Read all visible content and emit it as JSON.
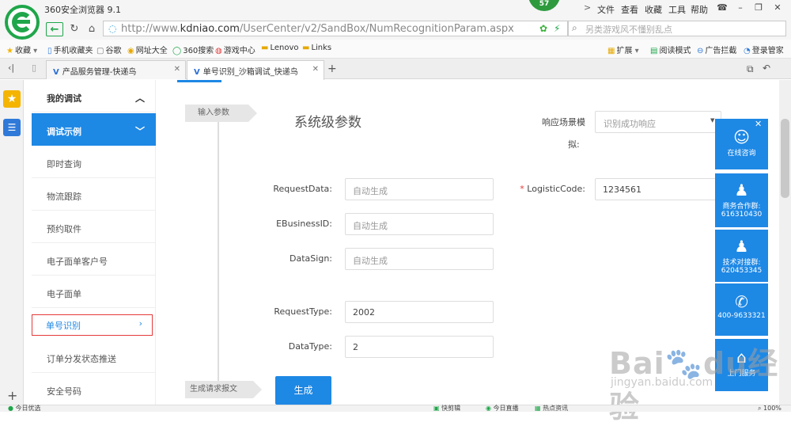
{
  "browser": {
    "title": "360安全浏览器 9.1",
    "badge": "57",
    "menus": [
      "文件",
      "查看",
      "收藏",
      "工具",
      "帮助"
    ],
    "url_prefix": "http://www.",
    "url_domain": "kdniao.com",
    "url_path": "/UserCenter/v2/SandBox/NumRecognitionParam.aspx",
    "search_placeholder": "另类游戏风不懂别乱点",
    "accent": "#1fa64a"
  },
  "bookmarks": {
    "left": [
      {
        "icon": "star-icon",
        "label": "收藏"
      },
      {
        "icon": "phone-icon",
        "label": "手机收藏夹"
      },
      {
        "icon": "page-icon",
        "label": "谷歌"
      },
      {
        "icon": "globe-icon",
        "label": "网址大全"
      },
      {
        "icon": "360-icon",
        "label": "360搜索"
      },
      {
        "icon": "game-icon",
        "label": "游戏中心"
      },
      {
        "icon": "folder-icon",
        "label": "Lenovo"
      },
      {
        "icon": "folder-icon",
        "label": "Links"
      }
    ],
    "right": [
      {
        "icon": "extension-icon",
        "label": "扩展"
      },
      {
        "icon": "reader-icon",
        "label": "阅读模式"
      },
      {
        "icon": "block-icon",
        "label": "广告拦截"
      },
      {
        "icon": "user-icon",
        "label": "登录管家"
      }
    ]
  },
  "tabs": [
    {
      "label": "产品服务管理-快递鸟",
      "active": false
    },
    {
      "label": "单号识别_沙箱调试_快递鸟",
      "active": true
    }
  ],
  "menu": {
    "head": "我的调试",
    "demo": "调试示例",
    "items": [
      "即时查询",
      "物流跟踪",
      "预约取件",
      "电子面单客户号",
      "电子面单",
      "单号识别",
      "订单分发状态推送",
      "安全号码"
    ],
    "selected": "单号识别"
  },
  "form": {
    "timeline_input": "输入参数",
    "timeline_generate": "生成请求报文",
    "section_title": "系统级参数",
    "scene_label_1": "响应场景模",
    "scene_label_2": "拟:",
    "scene_value": "识别成功响应",
    "request_data_label": "RequestData:",
    "request_data_placeholder": "自动生成",
    "logistic_required_mark": "*",
    "logistic_label": "LogisticCode:",
    "logistic_value": "1234561",
    "ebusiness_label": "EBusinessID:",
    "ebusiness_placeholder": "自动生成",
    "datasign_label": "DataSign:",
    "datasign_placeholder": "自动生成",
    "request_type_label": "RequestType:",
    "request_type_value": "2002",
    "data_type_label": "DataType:",
    "data_type_value": "2",
    "generate_button": "生成",
    "primary_color": "#1e88e5"
  },
  "service": {
    "online": "在线咨询",
    "business_title": "商务合作群:",
    "business_number": "616310430",
    "tech_title": "技术对接群:",
    "tech_number": "620453345",
    "phone": "400-9633321",
    "door": "上门服务"
  },
  "status": {
    "left": "今日优选",
    "items": [
      "快剪辑",
      "今日直播",
      "热点资讯"
    ],
    "zoom": "100%"
  },
  "watermark": {
    "line1": "Bai",
    "line1b": "du",
    "line1c": "经验",
    "line2": "jingyan.baidu.com"
  }
}
